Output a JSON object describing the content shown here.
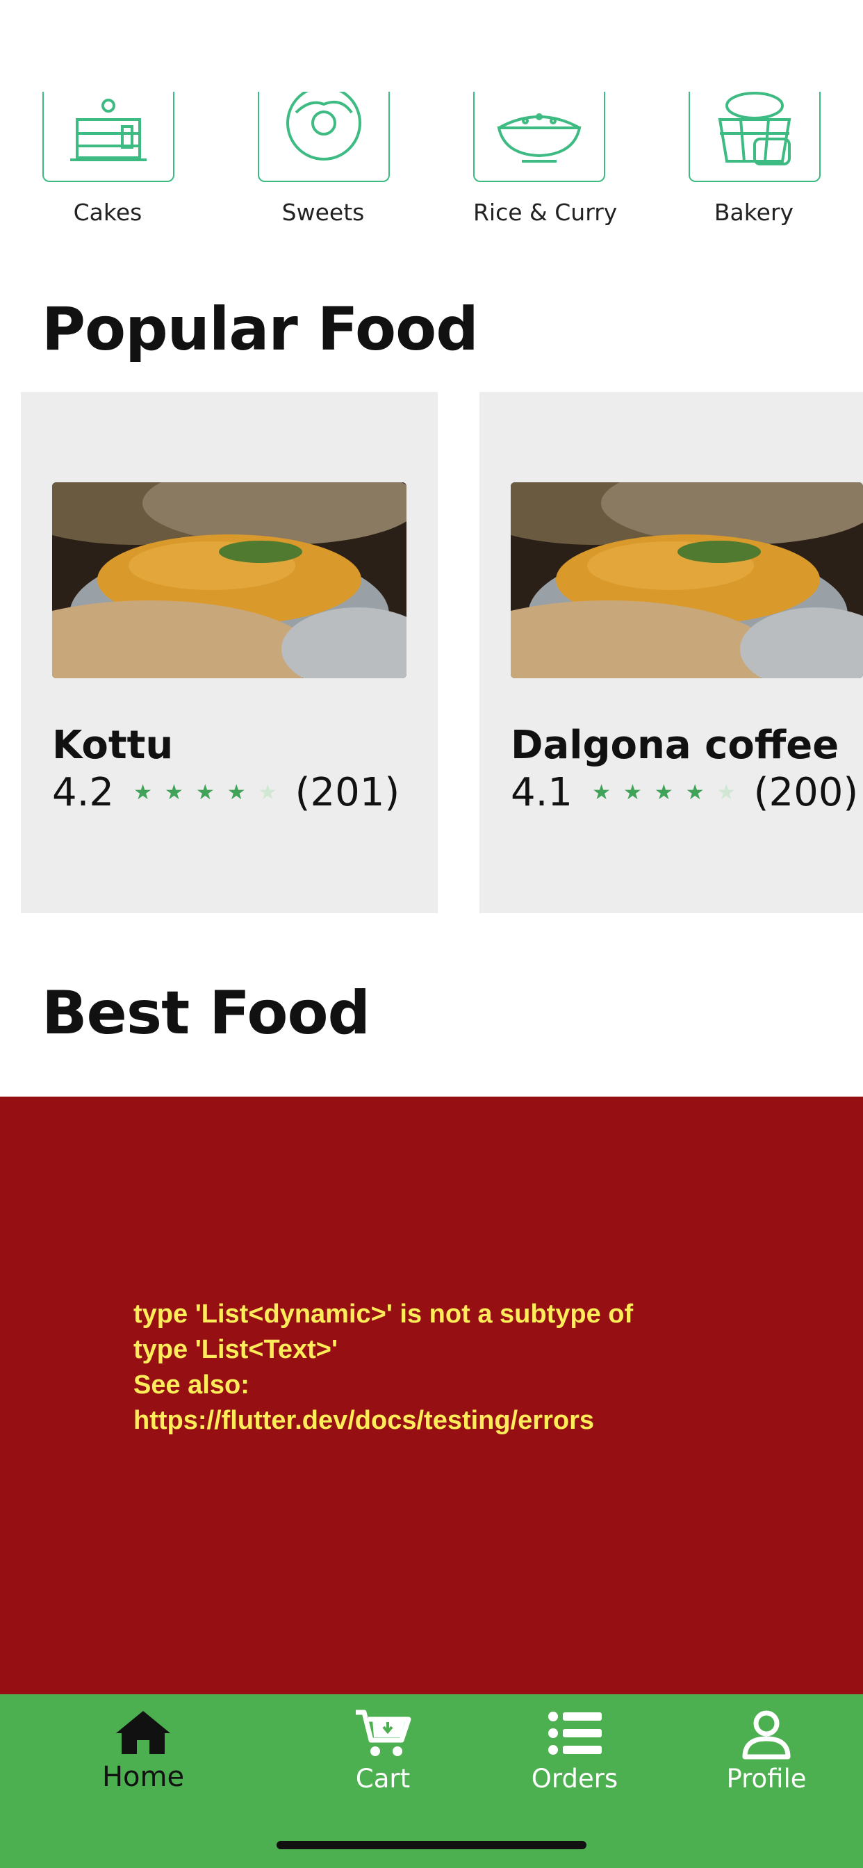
{
  "categories": [
    {
      "label": "Cakes",
      "icon": "cake-icon"
    },
    {
      "label": "Sweets",
      "icon": "donut-icon"
    },
    {
      "label": "Rice & Curry",
      "icon": "rice-bowl-icon"
    },
    {
      "label": "Bakery",
      "icon": "bread-basket-icon"
    }
  ],
  "popular": {
    "title": "Popular Food",
    "items": [
      {
        "name": "Kottu",
        "rating": "4.2",
        "count": "(201)",
        "stars": 4.2
      },
      {
        "name": "Dalgona coffee",
        "rating": "4.1",
        "count": "(200)",
        "stars": 4.1
      }
    ]
  },
  "best": {
    "title": "Best Food"
  },
  "error": {
    "message": "type 'List<dynamic>' is not a subtype of\ntype 'List<Text>'\nSee also:\nhttps://flutter.dev/docs/testing/errors"
  },
  "nav": {
    "items": [
      {
        "label": "Home",
        "icon": "home-icon",
        "active": true
      },
      {
        "label": "Cart",
        "icon": "cart-icon",
        "active": false
      },
      {
        "label": "Orders",
        "icon": "list-icon",
        "active": false
      },
      {
        "label": "Profile",
        "icon": "profile-icon",
        "active": false
      }
    ]
  },
  "colors": {
    "accent": "#4caf50",
    "category_outline": "#3dbb82",
    "error_bg": "#960f12",
    "error_text": "#ffec5a",
    "star": "#3fa458"
  }
}
